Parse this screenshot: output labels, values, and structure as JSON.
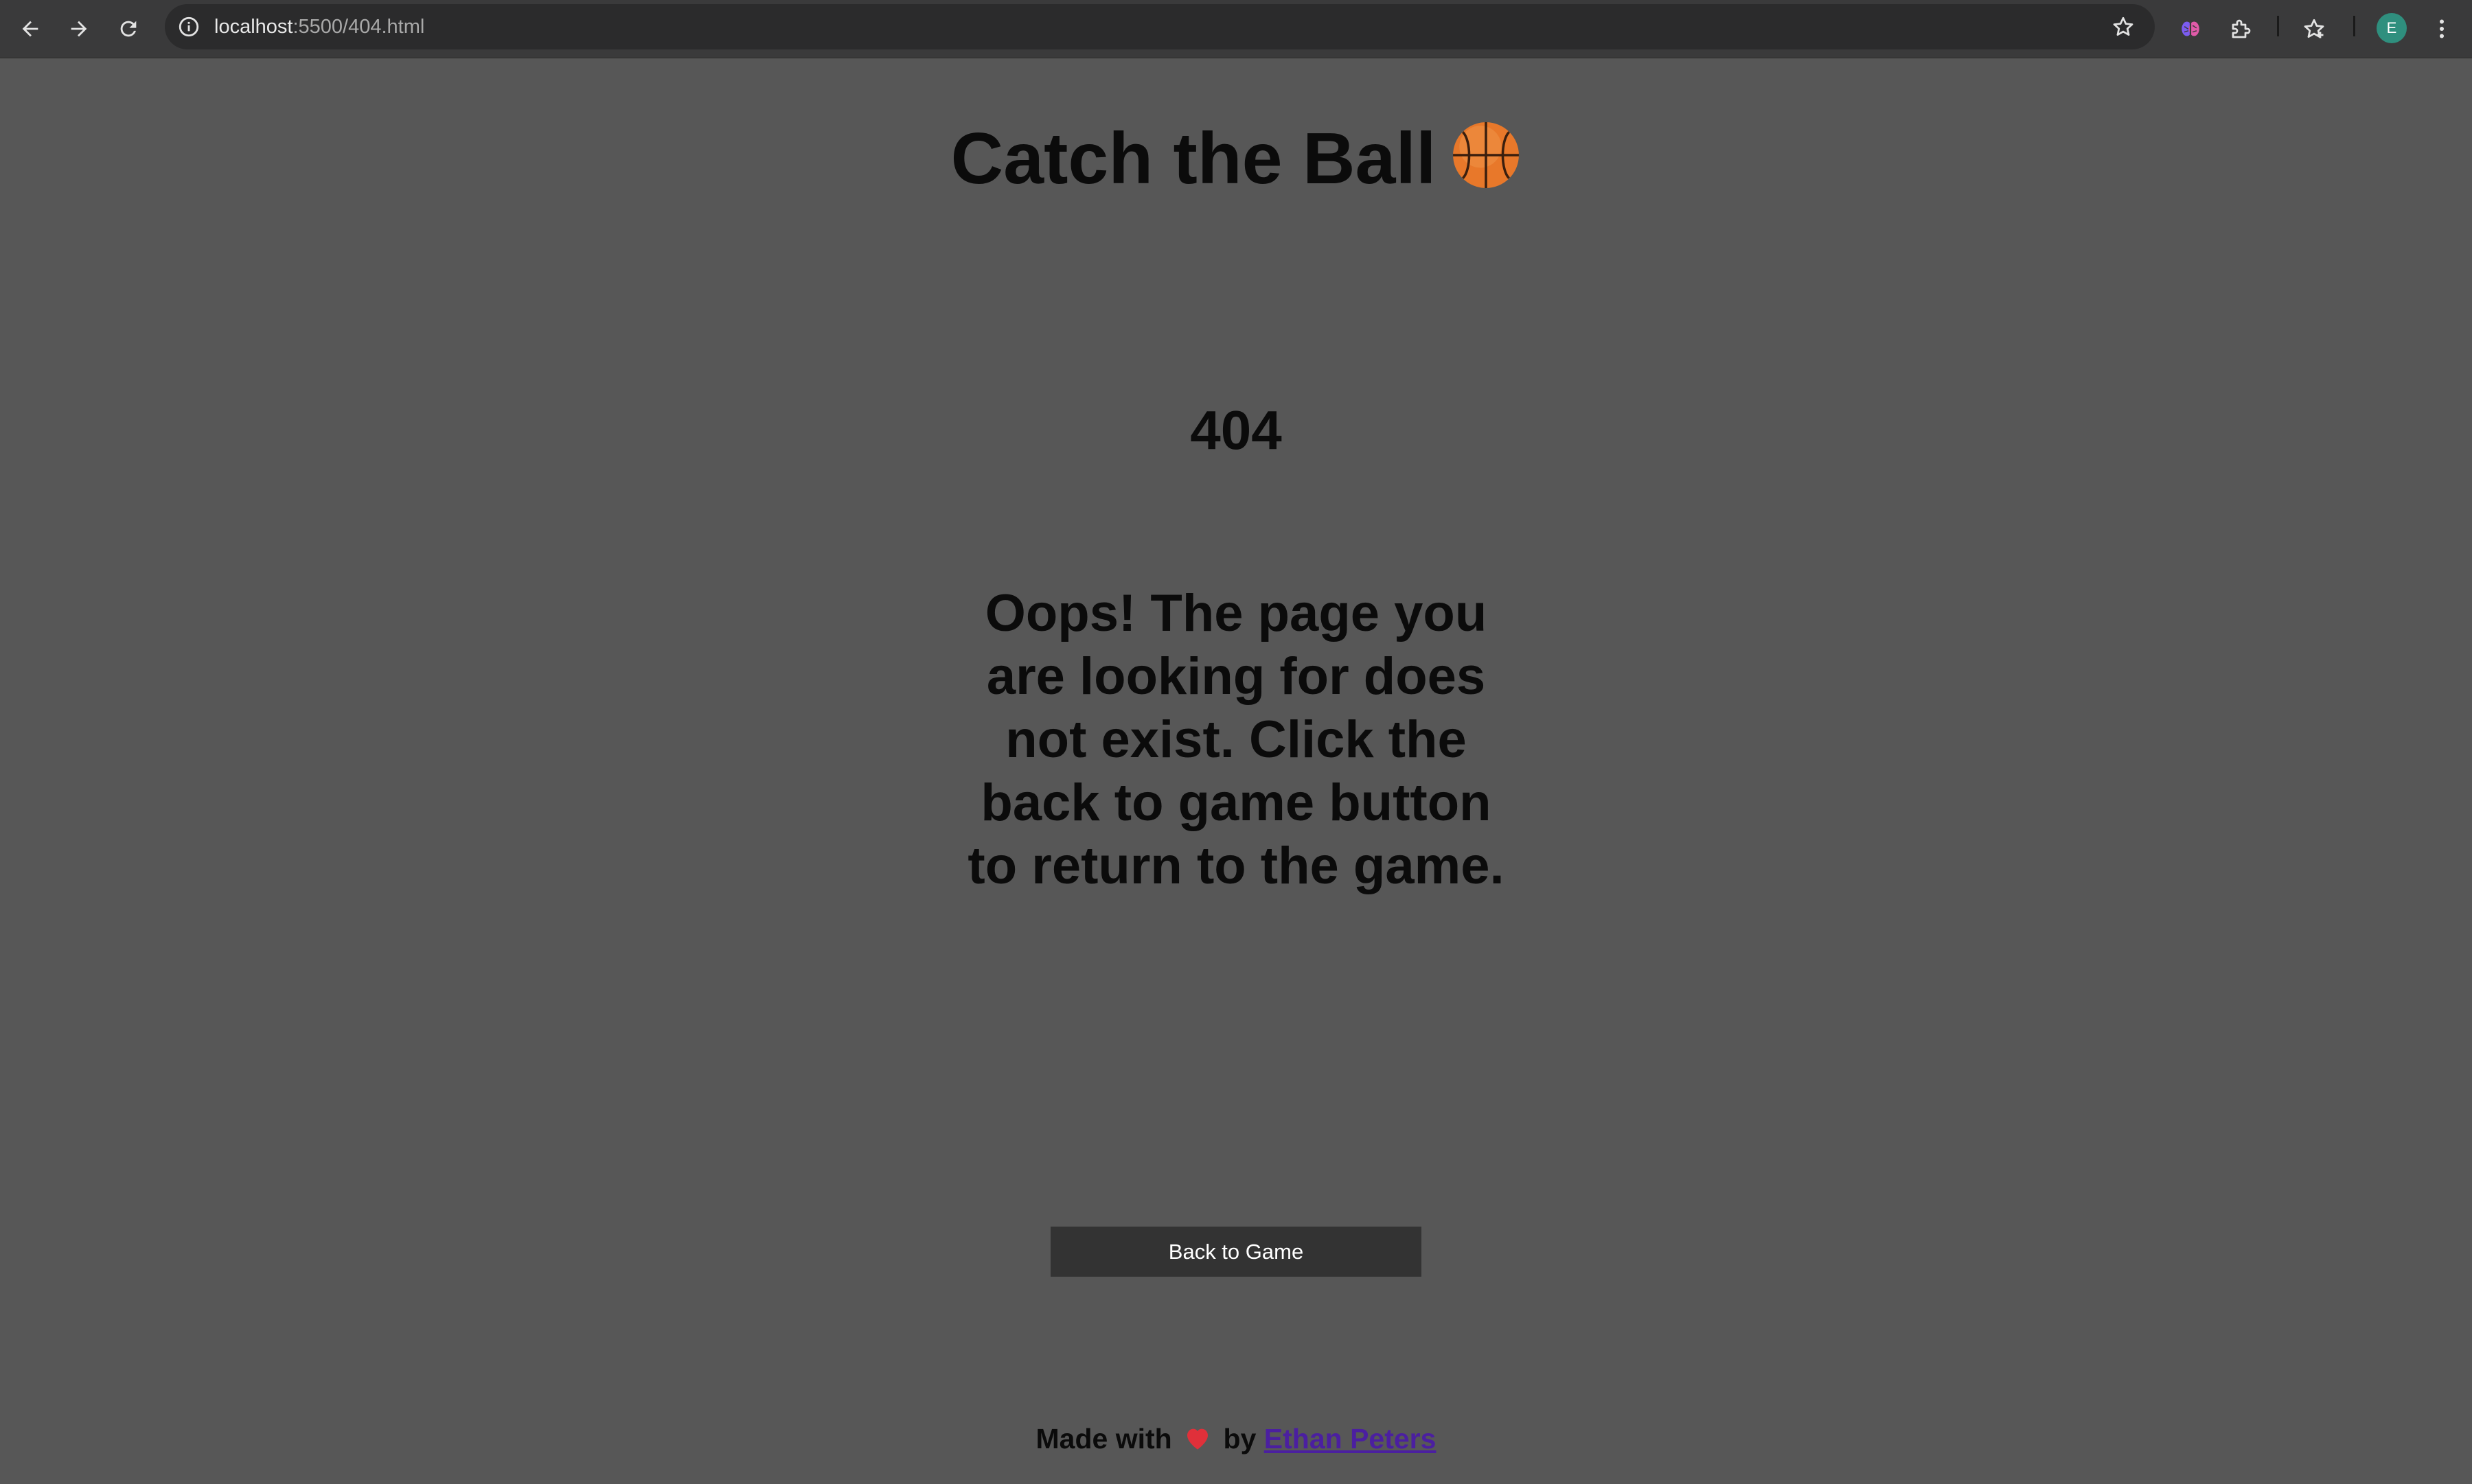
{
  "browser": {
    "url_host": "localhost",
    "url_path": ":5500/404.html",
    "profile_initial": "E",
    "nav_icons": [
      "back-arrow-icon",
      "forward-arrow-icon",
      "reload-icon"
    ],
    "toolbar_icons": [
      "site-info-icon",
      "bookmark-star-icon",
      "extension-brain-icon",
      "extensions-puzzle-icon",
      "bookmarks-icon",
      "menu-dots-icon"
    ]
  },
  "page": {
    "title": "Catch the Ball",
    "title_icon": "basketball-icon",
    "error_code": "404",
    "error_message": "Oops! The page you are looking for does not exist. Click the back to game button to return to the game.",
    "back_button_label": "Back to Game",
    "footer": {
      "prefix": "Made with",
      "icon": "heart-icon",
      "by": "by",
      "author": "Ethan Peters"
    }
  },
  "colors": {
    "background": "#575757",
    "button": "#333333",
    "link": "#4b1fa0",
    "heart": "#e0303a",
    "ball": "#e8782a"
  }
}
